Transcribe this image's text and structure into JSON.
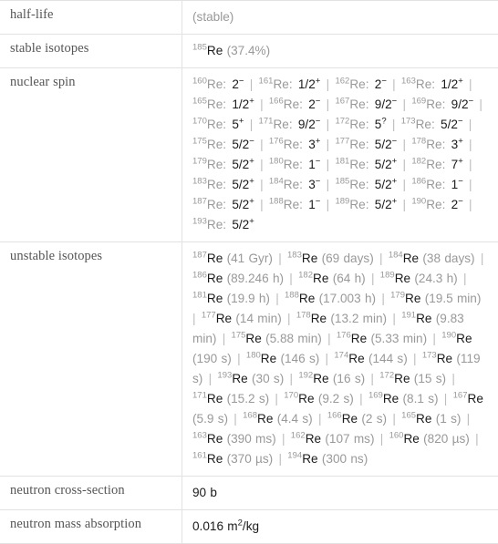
{
  "table": {
    "rows": [
      {
        "label": "half-life",
        "kind": "plain",
        "value": "(stable)",
        "value_muted": true
      },
      {
        "label": "stable isotopes",
        "kind": "isotope_list",
        "items": [
          {
            "mass": "185",
            "symbol": "Re",
            "detail": "(37.4%)"
          }
        ]
      },
      {
        "label": "nuclear spin",
        "kind": "spin_list",
        "items": [
          {
            "mass": "160",
            "symbol": "Re",
            "spin": "2",
            "sign": "−"
          },
          {
            "mass": "161",
            "symbol": "Re",
            "spin": "1/2",
            "sign": "+"
          },
          {
            "mass": "162",
            "symbol": "Re",
            "spin": "2",
            "sign": "−"
          },
          {
            "mass": "163",
            "symbol": "Re",
            "spin": "1/2",
            "sign": "+"
          },
          {
            "mass": "165",
            "symbol": "Re",
            "spin": "1/2",
            "sign": "+"
          },
          {
            "mass": "166",
            "symbol": "Re",
            "spin": "2",
            "sign": "−"
          },
          {
            "mass": "167",
            "symbol": "Re",
            "spin": "9/2",
            "sign": "−"
          },
          {
            "mass": "169",
            "symbol": "Re",
            "spin": "9/2",
            "sign": "−"
          },
          {
            "mass": "170",
            "symbol": "Re",
            "spin": "5",
            "sign": "+"
          },
          {
            "mass": "171",
            "symbol": "Re",
            "spin": "9/2",
            "sign": "−"
          },
          {
            "mass": "172",
            "symbol": "Re",
            "spin": "5",
            "sign": "?"
          },
          {
            "mass": "173",
            "symbol": "Re",
            "spin": "5/2",
            "sign": "−"
          },
          {
            "mass": "175",
            "symbol": "Re",
            "spin": "5/2",
            "sign": "−"
          },
          {
            "mass": "176",
            "symbol": "Re",
            "spin": "3",
            "sign": "+"
          },
          {
            "mass": "177",
            "symbol": "Re",
            "spin": "5/2",
            "sign": "−"
          },
          {
            "mass": "178",
            "symbol": "Re",
            "spin": "3",
            "sign": "+"
          },
          {
            "mass": "179",
            "symbol": "Re",
            "spin": "5/2",
            "sign": "+"
          },
          {
            "mass": "180",
            "symbol": "Re",
            "spin": "1",
            "sign": "−"
          },
          {
            "mass": "181",
            "symbol": "Re",
            "spin": "5/2",
            "sign": "+"
          },
          {
            "mass": "182",
            "symbol": "Re",
            "spin": "7",
            "sign": "+"
          },
          {
            "mass": "183",
            "symbol": "Re",
            "spin": "5/2",
            "sign": "+"
          },
          {
            "mass": "184",
            "symbol": "Re",
            "spin": "3",
            "sign": "−"
          },
          {
            "mass": "185",
            "symbol": "Re",
            "spin": "5/2",
            "sign": "+"
          },
          {
            "mass": "186",
            "symbol": "Re",
            "spin": "1",
            "sign": "−"
          },
          {
            "mass": "187",
            "symbol": "Re",
            "spin": "5/2",
            "sign": "+"
          },
          {
            "mass": "188",
            "symbol": "Re",
            "spin": "1",
            "sign": "−"
          },
          {
            "mass": "189",
            "symbol": "Re",
            "spin": "5/2",
            "sign": "+"
          },
          {
            "mass": "190",
            "symbol": "Re",
            "spin": "2",
            "sign": "−"
          },
          {
            "mass": "193",
            "symbol": "Re",
            "spin": "5/2",
            "sign": "+"
          }
        ]
      },
      {
        "label": "unstable isotopes",
        "kind": "isotope_list",
        "items": [
          {
            "mass": "187",
            "symbol": "Re",
            "detail": "(41 Gyr)"
          },
          {
            "mass": "183",
            "symbol": "Re",
            "detail": "(69 days)"
          },
          {
            "mass": "184",
            "symbol": "Re",
            "detail": "(38 days)"
          },
          {
            "mass": "186",
            "symbol": "Re",
            "detail": "(89.246 h)"
          },
          {
            "mass": "182",
            "symbol": "Re",
            "detail": "(64 h)"
          },
          {
            "mass": "189",
            "symbol": "Re",
            "detail": "(24.3 h)"
          },
          {
            "mass": "181",
            "symbol": "Re",
            "detail": "(19.9 h)"
          },
          {
            "mass": "188",
            "symbol": "Re",
            "detail": "(17.003 h)"
          },
          {
            "mass": "179",
            "symbol": "Re",
            "detail": "(19.5 min)"
          },
          {
            "mass": "177",
            "symbol": "Re",
            "detail": "(14 min)"
          },
          {
            "mass": "178",
            "symbol": "Re",
            "detail": "(13.2 min)"
          },
          {
            "mass": "191",
            "symbol": "Re",
            "detail": "(9.83 min)"
          },
          {
            "mass": "175",
            "symbol": "Re",
            "detail": "(5.88 min)"
          },
          {
            "mass": "176",
            "symbol": "Re",
            "detail": "(5.33 min)"
          },
          {
            "mass": "190",
            "symbol": "Re",
            "detail": "(190 s)"
          },
          {
            "mass": "180",
            "symbol": "Re",
            "detail": "(146 s)"
          },
          {
            "mass": "174",
            "symbol": "Re",
            "detail": "(144 s)"
          },
          {
            "mass": "173",
            "symbol": "Re",
            "detail": "(119 s)"
          },
          {
            "mass": "193",
            "symbol": "Re",
            "detail": "(30 s)"
          },
          {
            "mass": "192",
            "symbol": "Re",
            "detail": "(16 s)"
          },
          {
            "mass": "172",
            "symbol": "Re",
            "detail": "(15 s)"
          },
          {
            "mass": "171",
            "symbol": "Re",
            "detail": "(15.2 s)"
          },
          {
            "mass": "170",
            "symbol": "Re",
            "detail": "(9.2 s)"
          },
          {
            "mass": "169",
            "symbol": "Re",
            "detail": "(8.1 s)"
          },
          {
            "mass": "167",
            "symbol": "Re",
            "detail": "(5.9 s)"
          },
          {
            "mass": "168",
            "symbol": "Re",
            "detail": "(4.4 s)"
          },
          {
            "mass": "166",
            "symbol": "Re",
            "detail": "(2 s)"
          },
          {
            "mass": "165",
            "symbol": "Re",
            "detail": "(1 s)"
          },
          {
            "mass": "163",
            "symbol": "Re",
            "detail": "(390 ms)"
          },
          {
            "mass": "162",
            "symbol": "Re",
            "detail": "(107 ms)"
          },
          {
            "mass": "160",
            "symbol": "Re",
            "detail": "(820 µs)"
          },
          {
            "mass": "161",
            "symbol": "Re",
            "detail": "(370 µs)"
          },
          {
            "mass": "194",
            "symbol": "Re",
            "detail": "(300 ns)"
          }
        ]
      },
      {
        "label": "neutron cross-section",
        "kind": "plain",
        "value": "90 b",
        "value_muted": false
      },
      {
        "label": "neutron mass absorption",
        "kind": "superscript_unit",
        "value_pre": "0.016 m",
        "value_sup": "2",
        "value_post": "/kg"
      }
    ],
    "separator": "|"
  }
}
